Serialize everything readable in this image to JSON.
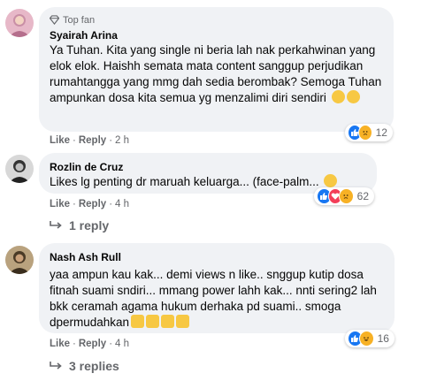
{
  "comments": [
    {
      "badge": "Top fan",
      "author": "Syairah Arina",
      "text": "Ya Tuhan. Kita yang single ni beria lah nak perkahwinan yang elok elok. Haishh semata mata content sanggup perjudikan rumahtangga yang mmg dah sedia berombak? Semoga Tuhan ampunkan dosa kita semua yg menzalimi diri sendiri",
      "like": "Like",
      "reply": "Reply",
      "time": "2 h",
      "reaction_count": "12"
    },
    {
      "author": "Rozlin de Cruz",
      "text": "Likes lg penting dr maruah keluarga... (face-palm...",
      "like": "Like",
      "reply": "Reply",
      "time": "4 h",
      "reaction_count": "62",
      "replies_link": "1 reply"
    },
    {
      "author": "Nash Ash Rull",
      "text": "yaa ampun kau kak... demi views n like.. snggup kutip dosa fitnah suami sndiri... mmang power lahh kak... nnti sering2 lah bkk ceramah agama hukum derhaka pd suami.. smoga dpermudahkan",
      "like": "Like",
      "reply": "Reply",
      "time": "4 h",
      "reaction_count": "16",
      "replies_link": "3 replies"
    }
  ],
  "colors": {
    "like_blue": "#1877f2",
    "love_red": "#f33e58",
    "haha_yellow": "#f7b125",
    "bubble_bg": "#f0f2f5",
    "meta_gray": "#65676b"
  }
}
